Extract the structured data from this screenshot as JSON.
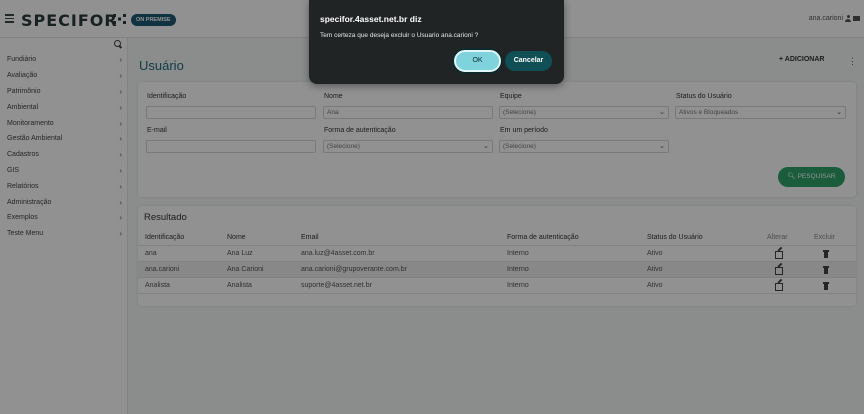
{
  "header": {
    "brand": "SPECIFOR",
    "badge": "ON PREMISE",
    "username": "ana.carioni"
  },
  "sidebar": {
    "items": [
      {
        "label": "Fundiário"
      },
      {
        "label": "Avaliação"
      },
      {
        "label": "Patrimônio"
      },
      {
        "label": "Ambiental"
      },
      {
        "label": "Monitoramento"
      },
      {
        "label": "Gestão Ambiental"
      },
      {
        "label": "Cadastros"
      },
      {
        "label": "GIS"
      },
      {
        "label": "Relatórios"
      },
      {
        "label": "Administração"
      },
      {
        "label": "Exemplos"
      },
      {
        "label": "Teste Menu"
      }
    ]
  },
  "main": {
    "title": "Usuário",
    "add_label": "+ ADICIONAR",
    "more_label": "⋮"
  },
  "filters": {
    "identificacao": {
      "label": "Identificação",
      "value": ""
    },
    "nome": {
      "label": "Nome",
      "value": "Ana"
    },
    "equipe": {
      "label": "Equipe",
      "value": "(Selecione)"
    },
    "status": {
      "label": "Status do Usuário",
      "value": "Ativos e Bloqueados"
    },
    "email": {
      "label": "E-mail",
      "value": ""
    },
    "forma": {
      "label": "Forma de autenticação",
      "value": "(Selecione)"
    },
    "periodo": {
      "label": "Em um período",
      "value": "(Selecione)"
    },
    "search_label": "PESQUISAR"
  },
  "results": {
    "title": "Resultado",
    "columns": [
      "Identificação",
      "Nome",
      "Email",
      "Forma de autenticação",
      "Status do Usuário",
      "Alterar",
      "Excluir"
    ],
    "rows": [
      {
        "id": "ana",
        "nome": "Ana Luz",
        "email": "ana.luz@4asset.com.br",
        "forma": "Interno",
        "status": "Ativo"
      },
      {
        "id": "ana.carioni",
        "nome": "Ana Carioni",
        "email": "ana.carioni@grupoverante.com.br",
        "forma": "Interno",
        "status": "Ativo"
      },
      {
        "id": "Analista",
        "nome": "Analista",
        "email": "suporte@4asset.net.br",
        "forma": "Interno",
        "status": "Ativo"
      }
    ]
  },
  "dialog": {
    "title": "specifor.4asset.net.br diz",
    "message": "Tem certeza que deseja excluir o Usuario ana.carioni ?",
    "ok_label": "OK",
    "cancel_label": "Cancelar"
  },
  "colors": {
    "accent": "#1f6b7e",
    "search_button": "#2ea36a",
    "dialog_bg": "#202424",
    "ok_button": "#7fd3dc",
    "cancel_button": "#0f4f55"
  }
}
